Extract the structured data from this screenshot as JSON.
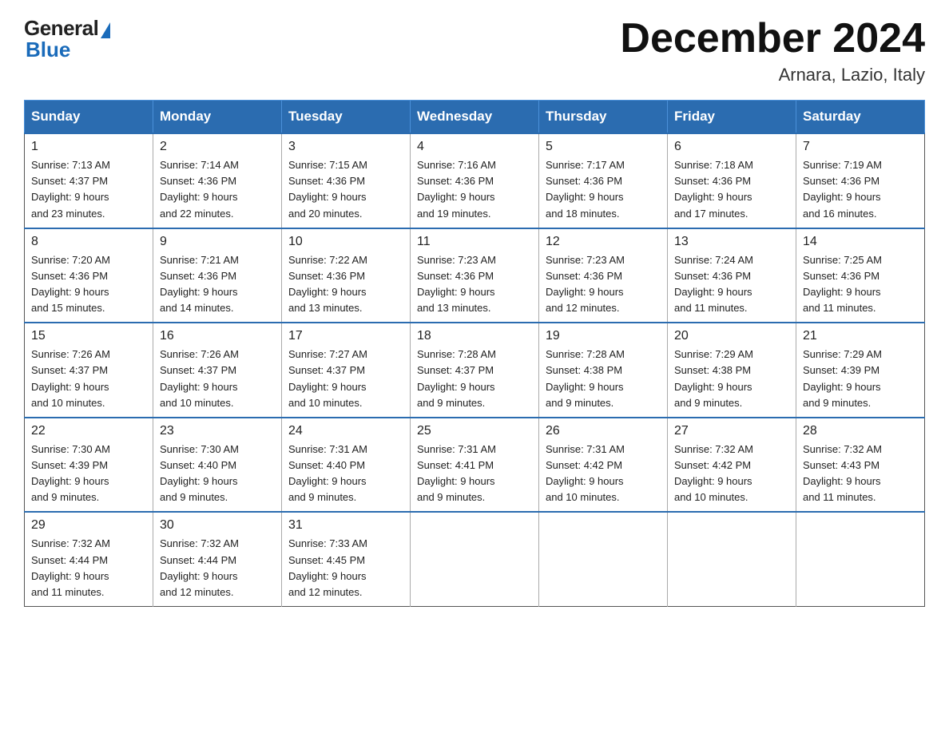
{
  "header": {
    "logo_general": "General",
    "logo_blue": "Blue",
    "month_title": "December 2024",
    "location": "Arnara, Lazio, Italy"
  },
  "days_of_week": [
    "Sunday",
    "Monday",
    "Tuesday",
    "Wednesday",
    "Thursday",
    "Friday",
    "Saturday"
  ],
  "weeks": [
    [
      {
        "day": "1",
        "sunrise": "7:13 AM",
        "sunset": "4:37 PM",
        "daylight": "9 hours and 23 minutes."
      },
      {
        "day": "2",
        "sunrise": "7:14 AM",
        "sunset": "4:36 PM",
        "daylight": "9 hours and 22 minutes."
      },
      {
        "day": "3",
        "sunrise": "7:15 AM",
        "sunset": "4:36 PM",
        "daylight": "9 hours and 20 minutes."
      },
      {
        "day": "4",
        "sunrise": "7:16 AM",
        "sunset": "4:36 PM",
        "daylight": "9 hours and 19 minutes."
      },
      {
        "day": "5",
        "sunrise": "7:17 AM",
        "sunset": "4:36 PM",
        "daylight": "9 hours and 18 minutes."
      },
      {
        "day": "6",
        "sunrise": "7:18 AM",
        "sunset": "4:36 PM",
        "daylight": "9 hours and 17 minutes."
      },
      {
        "day": "7",
        "sunrise": "7:19 AM",
        "sunset": "4:36 PM",
        "daylight": "9 hours and 16 minutes."
      }
    ],
    [
      {
        "day": "8",
        "sunrise": "7:20 AM",
        "sunset": "4:36 PM",
        "daylight": "9 hours and 15 minutes."
      },
      {
        "day": "9",
        "sunrise": "7:21 AM",
        "sunset": "4:36 PM",
        "daylight": "9 hours and 14 minutes."
      },
      {
        "day": "10",
        "sunrise": "7:22 AM",
        "sunset": "4:36 PM",
        "daylight": "9 hours and 13 minutes."
      },
      {
        "day": "11",
        "sunrise": "7:23 AM",
        "sunset": "4:36 PM",
        "daylight": "9 hours and 13 minutes."
      },
      {
        "day": "12",
        "sunrise": "7:23 AM",
        "sunset": "4:36 PM",
        "daylight": "9 hours and 12 minutes."
      },
      {
        "day": "13",
        "sunrise": "7:24 AM",
        "sunset": "4:36 PM",
        "daylight": "9 hours and 11 minutes."
      },
      {
        "day": "14",
        "sunrise": "7:25 AM",
        "sunset": "4:36 PM",
        "daylight": "9 hours and 11 minutes."
      }
    ],
    [
      {
        "day": "15",
        "sunrise": "7:26 AM",
        "sunset": "4:37 PM",
        "daylight": "9 hours and 10 minutes."
      },
      {
        "day": "16",
        "sunrise": "7:26 AM",
        "sunset": "4:37 PM",
        "daylight": "9 hours and 10 minutes."
      },
      {
        "day": "17",
        "sunrise": "7:27 AM",
        "sunset": "4:37 PM",
        "daylight": "9 hours and 10 minutes."
      },
      {
        "day": "18",
        "sunrise": "7:28 AM",
        "sunset": "4:37 PM",
        "daylight": "9 hours and 9 minutes."
      },
      {
        "day": "19",
        "sunrise": "7:28 AM",
        "sunset": "4:38 PM",
        "daylight": "9 hours and 9 minutes."
      },
      {
        "day": "20",
        "sunrise": "7:29 AM",
        "sunset": "4:38 PM",
        "daylight": "9 hours and 9 minutes."
      },
      {
        "day": "21",
        "sunrise": "7:29 AM",
        "sunset": "4:39 PM",
        "daylight": "9 hours and 9 minutes."
      }
    ],
    [
      {
        "day": "22",
        "sunrise": "7:30 AM",
        "sunset": "4:39 PM",
        "daylight": "9 hours and 9 minutes."
      },
      {
        "day": "23",
        "sunrise": "7:30 AM",
        "sunset": "4:40 PM",
        "daylight": "9 hours and 9 minutes."
      },
      {
        "day": "24",
        "sunrise": "7:31 AM",
        "sunset": "4:40 PM",
        "daylight": "9 hours and 9 minutes."
      },
      {
        "day": "25",
        "sunrise": "7:31 AM",
        "sunset": "4:41 PM",
        "daylight": "9 hours and 9 minutes."
      },
      {
        "day": "26",
        "sunrise": "7:31 AM",
        "sunset": "4:42 PM",
        "daylight": "9 hours and 10 minutes."
      },
      {
        "day": "27",
        "sunrise": "7:32 AM",
        "sunset": "4:42 PM",
        "daylight": "9 hours and 10 minutes."
      },
      {
        "day": "28",
        "sunrise": "7:32 AM",
        "sunset": "4:43 PM",
        "daylight": "9 hours and 11 minutes."
      }
    ],
    [
      {
        "day": "29",
        "sunrise": "7:32 AM",
        "sunset": "4:44 PM",
        "daylight": "9 hours and 11 minutes."
      },
      {
        "day": "30",
        "sunrise": "7:32 AM",
        "sunset": "4:44 PM",
        "daylight": "9 hours and 12 minutes."
      },
      {
        "day": "31",
        "sunrise": "7:33 AM",
        "sunset": "4:45 PM",
        "daylight": "9 hours and 12 minutes."
      },
      null,
      null,
      null,
      null
    ]
  ],
  "labels": {
    "sunrise": "Sunrise: ",
    "sunset": "Sunset: ",
    "daylight": "Daylight: "
  }
}
